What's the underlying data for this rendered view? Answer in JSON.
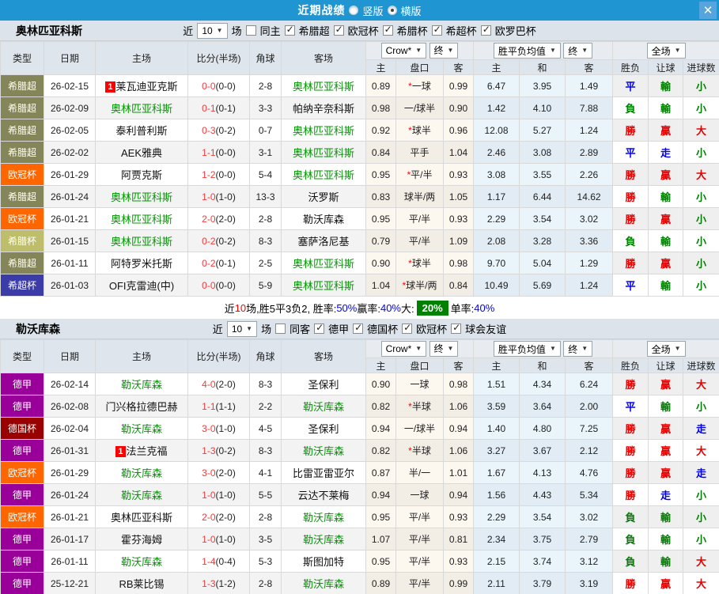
{
  "titlebar": {
    "title": "近期战绩",
    "vertical_label": "竖版",
    "horizontal_label": "横版",
    "vertical_selected": false,
    "horizontal_selected": true,
    "close_icon": "✕"
  },
  "table": {
    "columns": [
      "类型",
      "日期",
      "主场",
      "比分(半场)",
      "角球",
      "客场"
    ],
    "subcolumns": [
      "主",
      "盘口",
      "客",
      "主",
      "和",
      "客",
      "胜负",
      "让球",
      "进球数"
    ],
    "dropdowns": {
      "crown": "Crow*",
      "final": "终",
      "avg": "胜平负均值",
      "full": "全场"
    },
    "arrow_icon": "▼"
  },
  "colors": {
    "titlebar_bg": "#1F96D2",
    "close_btn_bg": "#58A4DE",
    "section_header_bg": "#DCE3EB",
    "win": "#E60000",
    "draw": "#0000EE",
    "loss": "#008000",
    "score": "#F33B3B",
    "team_highlight": "#009900",
    "leagues": {
      "希腊超": "#85855A",
      "欧冠杯": "#FF6600",
      "希腊杯": "#BDBD6B",
      "希超杯": "#3C3CA8",
      "德甲": "#990099",
      "德国杯": "#990000"
    }
  },
  "sections": [
    {
      "team": "奥林匹亚科斯",
      "filters": {
        "near": "近",
        "count": "10",
        "games": "场",
        "same": "同主",
        "same_checked": false,
        "leagues": [
          "希腊超",
          "欧冠杯",
          "希腊杯",
          "希超杯",
          "欧罗巴杯"
        ]
      },
      "rows": [
        {
          "league": "希腊超",
          "date": "26-02-15",
          "home": "莱瓦迪亚克斯",
          "home_rank": "1",
          "home_hl": false,
          "score": "0-0",
          "half": "0-0",
          "corners": "2-8",
          "away": "奥林匹亚科斯",
          "away_hl": true,
          "crown_home": "0.89",
          "handicap_star": true,
          "handicap": "一球",
          "crown_away": "0.99",
          "avg_home": "6.47",
          "avg_draw": "3.95",
          "avg_away": "1.49",
          "result": "平",
          "handicap_result": "輸",
          "goals": "小"
        },
        {
          "league": "希腊超",
          "date": "26-02-09",
          "home": "奥林匹亚科斯",
          "home_rank": "",
          "home_hl": true,
          "score": "0-1",
          "half": "0-1",
          "corners": "3-3",
          "away": "帕纳辛奈科斯",
          "away_hl": false,
          "crown_home": "0.98",
          "handicap_star": false,
          "handicap": "一/球半",
          "crown_away": "0.90",
          "avg_home": "1.42",
          "avg_draw": "4.10",
          "avg_away": "7.88",
          "result": "負",
          "handicap_result": "輸",
          "goals": "小"
        },
        {
          "league": "希腊超",
          "date": "26-02-05",
          "home": "泰利普利斯",
          "home_rank": "",
          "home_hl": false,
          "score": "0-3",
          "half": "0-2",
          "corners": "0-7",
          "away": "奥林匹亚科斯",
          "away_hl": true,
          "crown_home": "0.92",
          "handicap_star": true,
          "handicap": "球半",
          "crown_away": "0.96",
          "avg_home": "12.08",
          "avg_draw": "5.27",
          "avg_away": "1.24",
          "result": "勝",
          "handicap_result": "贏",
          "goals": "大"
        },
        {
          "league": "希腊超",
          "date": "26-02-02",
          "home": "AEK雅典",
          "home_rank": "",
          "home_hl": false,
          "score": "1-1",
          "half": "0-0",
          "corners": "3-1",
          "away": "奥林匹亚科斯",
          "away_hl": true,
          "crown_home": "0.84",
          "handicap_star": false,
          "handicap": "平手",
          "crown_away": "1.04",
          "avg_home": "2.46",
          "avg_draw": "3.08",
          "avg_away": "2.89",
          "result": "平",
          "handicap_result": "走",
          "goals": "小"
        },
        {
          "league": "欧冠杯",
          "date": "26-01-29",
          "home": "阿贾克斯",
          "home_rank": "",
          "home_hl": false,
          "score": "1-2",
          "half": "0-0",
          "corners": "5-4",
          "away": "奥林匹亚科斯",
          "away_hl": true,
          "crown_home": "0.95",
          "handicap_star": true,
          "handicap": "平/半",
          "crown_away": "0.93",
          "avg_home": "3.08",
          "avg_draw": "3.55",
          "avg_away": "2.26",
          "result": "勝",
          "handicap_result": "贏",
          "goals": "大"
        },
        {
          "league": "希腊超",
          "date": "26-01-24",
          "home": "奥林匹亚科斯",
          "home_rank": "",
          "home_hl": true,
          "score": "1-0",
          "half": "1-0",
          "corners": "13-3",
          "away": "沃罗斯",
          "away_hl": false,
          "crown_home": "0.83",
          "handicap_star": false,
          "handicap": "球半/两",
          "crown_away": "1.05",
          "avg_home": "1.17",
          "avg_draw": "6.44",
          "avg_away": "14.62",
          "result": "勝",
          "handicap_result": "輸",
          "goals": "小"
        },
        {
          "league": "欧冠杯",
          "date": "26-01-21",
          "home": "奥林匹亚科斯",
          "home_rank": "",
          "home_hl": true,
          "score": "2-0",
          "half": "2-0",
          "corners": "2-8",
          "away": "勒沃库森",
          "away_hl": false,
          "crown_home": "0.95",
          "handicap_star": false,
          "handicap": "平/半",
          "crown_away": "0.93",
          "avg_home": "2.29",
          "avg_draw": "3.54",
          "avg_away": "3.02",
          "result": "勝",
          "handicap_result": "贏",
          "goals": "小"
        },
        {
          "league": "希腊杯",
          "date": "26-01-15",
          "home": "奥林匹亚科斯",
          "home_rank": "",
          "home_hl": true,
          "score": "0-2",
          "half": "0-2",
          "corners": "8-3",
          "away": "塞萨洛尼基",
          "away_hl": false,
          "crown_home": "0.79",
          "handicap_star": false,
          "handicap": "平/半",
          "crown_away": "1.09",
          "avg_home": "2.08",
          "avg_draw": "3.28",
          "avg_away": "3.36",
          "result": "負",
          "handicap_result": "輸",
          "goals": "小"
        },
        {
          "league": "希腊超",
          "date": "26-01-11",
          "home": "阿特罗米托斯",
          "home_rank": "",
          "home_hl": false,
          "score": "0-2",
          "half": "0-1",
          "corners": "2-5",
          "away": "奥林匹亚科斯",
          "away_hl": true,
          "crown_home": "0.90",
          "handicap_star": true,
          "handicap": "球半",
          "crown_away": "0.98",
          "avg_home": "9.70",
          "avg_draw": "5.04",
          "avg_away": "1.29",
          "result": "勝",
          "handicap_result": "贏",
          "goals": "小"
        },
        {
          "league": "希超杯",
          "date": "26-01-03",
          "home": "OFI克雷迪(中)",
          "home_rank": "",
          "home_hl": false,
          "score": "0-0",
          "half": "0-0",
          "corners": "5-9",
          "away": "奥林匹亚科斯",
          "away_hl": true,
          "crown_home": "1.04",
          "handicap_star": true,
          "handicap": "球半/两",
          "crown_away": "0.84",
          "avg_home": "10.49",
          "avg_draw": "5.69",
          "avg_away": "1.24",
          "result": "平",
          "handicap_result": "輸",
          "goals": "小"
        }
      ],
      "summary": [
        {
          "text": "近",
          "style": "plain"
        },
        {
          "text": "10",
          "style": "red"
        },
        {
          "text": "场,胜5平3负2, 胜率:",
          "style": "plain"
        },
        {
          "text": "50%",
          "style": "blue"
        },
        {
          "text": " 赢率:",
          "style": "plain"
        },
        {
          "text": "40%",
          "style": "blue"
        },
        {
          "text": " 大:",
          "style": "plain"
        },
        {
          "text": "20%",
          "style": "green-badge"
        },
        {
          "text": " 单率:",
          "style": "plain"
        },
        {
          "text": "40%",
          "style": "blue"
        }
      ]
    },
    {
      "team": "勒沃库森",
      "filters": {
        "near": "近",
        "count": "10",
        "games": "场",
        "same": "同客",
        "same_checked": false,
        "leagues": [
          "德甲",
          "德国杯",
          "欧冠杯",
          "球会友谊"
        ]
      },
      "rows": [
        {
          "league": "德甲",
          "date": "26-02-14",
          "home": "勒沃库森",
          "home_rank": "",
          "home_hl": true,
          "score": "4-0",
          "half": "2-0",
          "corners": "8-3",
          "away": "圣保利",
          "away_hl": false,
          "crown_home": "0.90",
          "handicap_star": false,
          "handicap": "一球",
          "crown_away": "0.98",
          "avg_home": "1.51",
          "avg_draw": "4.34",
          "avg_away": "6.24",
          "result": "勝",
          "handicap_result": "贏",
          "goals": "大"
        },
        {
          "league": "德甲",
          "date": "26-02-08",
          "home": "门兴格拉德巴赫",
          "home_rank": "",
          "home_hl": false,
          "score": "1-1",
          "half": "1-1",
          "corners": "2-2",
          "away": "勒沃库森",
          "away_hl": true,
          "crown_home": "0.82",
          "handicap_star": true,
          "handicap": "半球",
          "crown_away": "1.06",
          "avg_home": "3.59",
          "avg_draw": "3.64",
          "avg_away": "2.00",
          "result": "平",
          "handicap_result": "輸",
          "goals": "小"
        },
        {
          "league": "德国杯",
          "date": "26-02-04",
          "home": "勒沃库森",
          "home_rank": "",
          "home_hl": true,
          "score": "3-0",
          "half": "1-0",
          "corners": "4-5",
          "away": "圣保利",
          "away_hl": false,
          "crown_home": "0.94",
          "handicap_star": false,
          "handicap": "一/球半",
          "crown_away": "0.94",
          "avg_home": "1.40",
          "avg_draw": "4.80",
          "avg_away": "7.25",
          "result": "勝",
          "handicap_result": "贏",
          "goals": "走"
        },
        {
          "league": "德甲",
          "date": "26-01-31",
          "home": "法兰克福",
          "home_rank": "1",
          "home_hl": false,
          "score": "1-3",
          "half": "0-2",
          "corners": "8-3",
          "away": "勒沃库森",
          "away_hl": true,
          "crown_home": "0.82",
          "handicap_star": true,
          "handicap": "半球",
          "crown_away": "1.06",
          "avg_home": "3.27",
          "avg_draw": "3.67",
          "avg_away": "2.12",
          "result": "勝",
          "handicap_result": "贏",
          "goals": "大"
        },
        {
          "league": "欧冠杯",
          "date": "26-01-29",
          "home": "勒沃库森",
          "home_rank": "",
          "home_hl": true,
          "score": "3-0",
          "half": "2-0",
          "corners": "4-1",
          "away": "比雷亚雷亚尔",
          "away_hl": false,
          "crown_home": "0.87",
          "handicap_star": false,
          "handicap": "半/一",
          "crown_away": "1.01",
          "avg_home": "1.67",
          "avg_draw": "4.13",
          "avg_away": "4.76",
          "result": "勝",
          "handicap_result": "贏",
          "goals": "走"
        },
        {
          "league": "德甲",
          "date": "26-01-24",
          "home": "勒沃库森",
          "home_rank": "",
          "home_hl": true,
          "score": "1-0",
          "half": "1-0",
          "corners": "5-5",
          "away": "云达不莱梅",
          "away_hl": false,
          "crown_home": "0.94",
          "handicap_star": false,
          "handicap": "一球",
          "crown_away": "0.94",
          "avg_home": "1.56",
          "avg_draw": "4.43",
          "avg_away": "5.34",
          "result": "勝",
          "handicap_result": "走",
          "goals": "小"
        },
        {
          "league": "欧冠杯",
          "date": "26-01-21",
          "home": "奥林匹亚科斯",
          "home_rank": "",
          "home_hl": false,
          "score": "2-0",
          "half": "2-0",
          "corners": "2-8",
          "away": "勒沃库森",
          "away_hl": true,
          "crown_home": "0.95",
          "handicap_star": false,
          "handicap": "平/半",
          "crown_away": "0.93",
          "avg_home": "2.29",
          "avg_draw": "3.54",
          "avg_away": "3.02",
          "result": "負",
          "handicap_result": "輸",
          "goals": "小"
        },
        {
          "league": "德甲",
          "date": "26-01-17",
          "home": "霍芬海姆",
          "home_rank": "",
          "home_hl": false,
          "score": "1-0",
          "half": "1-0",
          "corners": "3-5",
          "away": "勒沃库森",
          "away_hl": true,
          "crown_home": "1.07",
          "handicap_star": false,
          "handicap": "平/半",
          "crown_away": "0.81",
          "avg_home": "2.34",
          "avg_draw": "3.75",
          "avg_away": "2.79",
          "result": "負",
          "handicap_result": "輸",
          "goals": "小"
        },
        {
          "league": "德甲",
          "date": "26-01-11",
          "home": "勒沃库森",
          "home_rank": "",
          "home_hl": true,
          "score": "1-4",
          "half": "0-4",
          "corners": "5-3",
          "away": "斯图加特",
          "away_hl": false,
          "crown_home": "0.95",
          "handicap_star": false,
          "handicap": "平/半",
          "crown_away": "0.93",
          "avg_home": "2.15",
          "avg_draw": "3.74",
          "avg_away": "3.12",
          "result": "負",
          "handicap_result": "輸",
          "goals": "大"
        },
        {
          "league": "德甲",
          "date": "25-12-21",
          "home": "RB莱比锡",
          "home_rank": "",
          "home_hl": false,
          "score": "1-3",
          "half": "1-2",
          "corners": "2-8",
          "away": "勒沃库森",
          "away_hl": true,
          "crown_home": "0.89",
          "handicap_star": false,
          "handicap": "平/半",
          "crown_away": "0.99",
          "avg_home": "2.11",
          "avg_draw": "3.79",
          "avg_away": "3.19",
          "result": "勝",
          "handicap_result": "贏",
          "goals": "大"
        }
      ],
      "summary": null
    }
  ]
}
